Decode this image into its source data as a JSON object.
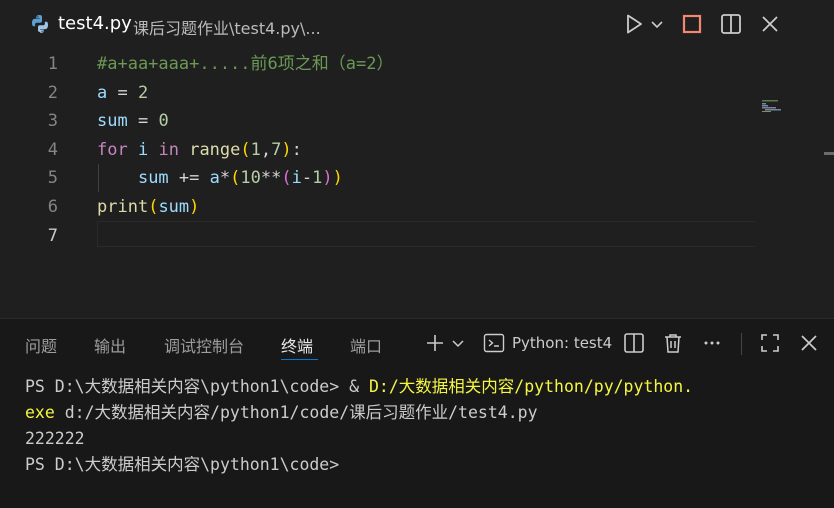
{
  "titlebar": {
    "file_icon": "python-icon",
    "title": "test4.py",
    "path": "课后习题作业\\test4.py\\...",
    "actions": [
      "run-icon",
      "chevron-down-icon",
      "stop-icon",
      "split-editor-icon",
      "close-icon"
    ]
  },
  "editor": {
    "lines": [
      {
        "number": "1",
        "segments": [
          {
            "text": "#a+aa+aaa+.....前6项之和（a=2）",
            "cls": "c-comment"
          }
        ]
      },
      {
        "number": "2",
        "segments": [
          {
            "text": "a",
            "cls": "c-var"
          },
          {
            "text": " = ",
            "cls": "c-op"
          },
          {
            "text": "2",
            "cls": "c-num"
          }
        ]
      },
      {
        "number": "3",
        "segments": [
          {
            "text": "sum",
            "cls": "c-var"
          },
          {
            "text": " = ",
            "cls": "c-op"
          },
          {
            "text": "0",
            "cls": "c-num"
          }
        ]
      },
      {
        "number": "4",
        "segments": [
          {
            "text": "for",
            "cls": "c-kw"
          },
          {
            "text": " ",
            "cls": "c-op"
          },
          {
            "text": "i",
            "cls": "c-var"
          },
          {
            "text": " ",
            "cls": "c-op"
          },
          {
            "text": "in",
            "cls": "c-kw"
          },
          {
            "text": " ",
            "cls": "c-op"
          },
          {
            "text": "range",
            "cls": "c-fn"
          },
          {
            "text": "(",
            "cls": "c-p1"
          },
          {
            "text": "1",
            "cls": "c-num"
          },
          {
            "text": ",",
            "cls": "c-op"
          },
          {
            "text": "7",
            "cls": "c-num"
          },
          {
            "text": ")",
            "cls": "c-p1"
          },
          {
            "text": ":",
            "cls": "c-op"
          }
        ]
      },
      {
        "number": "5",
        "segments": [
          {
            "text": "    ",
            "cls": "c-op"
          },
          {
            "text": "sum",
            "cls": "c-var"
          },
          {
            "text": " += ",
            "cls": "c-op"
          },
          {
            "text": "a",
            "cls": "c-var"
          },
          {
            "text": "*",
            "cls": "c-op"
          },
          {
            "text": "(",
            "cls": "c-p1"
          },
          {
            "text": "10",
            "cls": "c-num"
          },
          {
            "text": "**",
            "cls": "c-op"
          },
          {
            "text": "(",
            "cls": "c-p2"
          },
          {
            "text": "i",
            "cls": "c-var"
          },
          {
            "text": "-",
            "cls": "c-op"
          },
          {
            "text": "1",
            "cls": "c-num"
          },
          {
            "text": ")",
            "cls": "c-p2"
          },
          {
            "text": ")",
            "cls": "c-p1"
          }
        ]
      },
      {
        "number": "6",
        "segments": [
          {
            "text": "print",
            "cls": "c-fn"
          },
          {
            "text": "(",
            "cls": "c-p1"
          },
          {
            "text": "sum",
            "cls": "c-var"
          },
          {
            "text": ")",
            "cls": "c-p1"
          }
        ]
      },
      {
        "number": "7",
        "segments": []
      }
    ]
  },
  "panel": {
    "tabs": [
      {
        "label": "问题",
        "active": false
      },
      {
        "label": "输出",
        "active": false
      },
      {
        "label": "调试控制台",
        "active": false
      },
      {
        "label": "终端",
        "active": true
      },
      {
        "label": "端口",
        "active": false
      }
    ],
    "terminal_name": "Python: test4",
    "actions": [
      "plus-icon",
      "chevron-down-icon",
      "terminal-icon",
      "split-terminal-icon",
      "trash-icon",
      "more-icon",
      "maximize-icon",
      "close-icon"
    ],
    "terminal_lines": [
      [
        {
          "text": "PS D:\\大数据相关内容\\python1\\code> & ",
          "cls": ""
        },
        {
          "text": "D:/大数据相关内容/python/py/python.",
          "cls": "t-yellow"
        }
      ],
      [
        {
          "text": "exe",
          "cls": "t-yellow"
        },
        {
          "text": " d:/大数据相关内容/python1/code/课后习题作业/test4.py",
          "cls": ""
        }
      ],
      [
        {
          "text": "222222",
          "cls": ""
        }
      ],
      [
        {
          "text": "PS D:\\大数据相关内容\\python1\\code>",
          "cls": ""
        }
      ]
    ]
  }
}
